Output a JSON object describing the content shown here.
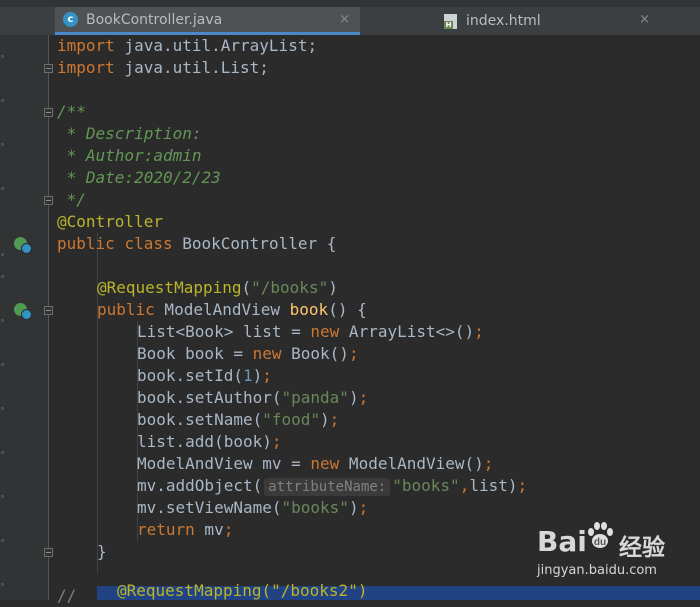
{
  "tabs": [
    {
      "label": "BookController.java",
      "icon": "java-class-icon",
      "active": true,
      "close": "×"
    },
    {
      "label": "index.html",
      "icon": "html-file-icon",
      "active": false,
      "close": "×"
    }
  ],
  "code": {
    "l1": {
      "kw": "import",
      "rest": " java.util.ArrayList;"
    },
    "l2": {
      "kw": "import",
      "rest": " java.util.List;"
    },
    "l4": "/**",
    "l5": " * Description:",
    "l6": " * Author:admin",
    "l7": " * Date:2020/2/23",
    "l8": " */",
    "l9": "@Controller",
    "l10": {
      "kw1": "public",
      "kw2": "class",
      "name": " BookController {"
    },
    "l12": {
      "ann": "@RequestMapping",
      "open": "(",
      "str": "\"/books\"",
      "close": ")"
    },
    "l13": {
      "kw": "public",
      "type": " ModelAndView ",
      "method": "book",
      "rest": "() {"
    },
    "l14": {
      "a": "List<Book> list = ",
      "kw": "new",
      "b": " ArrayList<>()",
      "semi": ";"
    },
    "l15": {
      "a": "Book book = ",
      "kw": "new",
      "b": " Book()",
      "semi": ";"
    },
    "l16": {
      "a": "book.setId(",
      "num": "1",
      "b": ")",
      "semi": ";"
    },
    "l17": {
      "a": "book.setAuthor(",
      "str": "\"panda\"",
      "b": ")",
      "semi": ";"
    },
    "l18": {
      "a": "book.setName(",
      "str": "\"food\"",
      "b": ")",
      "semi": ";"
    },
    "l19": {
      "a": "list.add(book)",
      "semi": ";"
    },
    "l20": {
      "a": "ModelAndView mv = ",
      "kw": "new",
      "b": " ModelAndView()",
      "semi": ";"
    },
    "l21": {
      "a": "mv.addObject(",
      "hint": "attributeName:",
      "str": "\"books\"",
      "comma": ",",
      "b": "list)",
      "semi": ";"
    },
    "l22": {
      "a": "mv.setViewName(",
      "str": "\"books\"",
      "b": ")",
      "semi": ";"
    },
    "l23": {
      "kw": "return",
      "b": " mv",
      "semi": ";"
    },
    "l24": "}",
    "l26": {
      "comment": "//",
      "sel": "@RequestMapping(\"/books2\")"
    }
  },
  "watermark": {
    "logo": "Bai",
    "logo2": "经验",
    "url": "jingyan.baidu.com"
  }
}
